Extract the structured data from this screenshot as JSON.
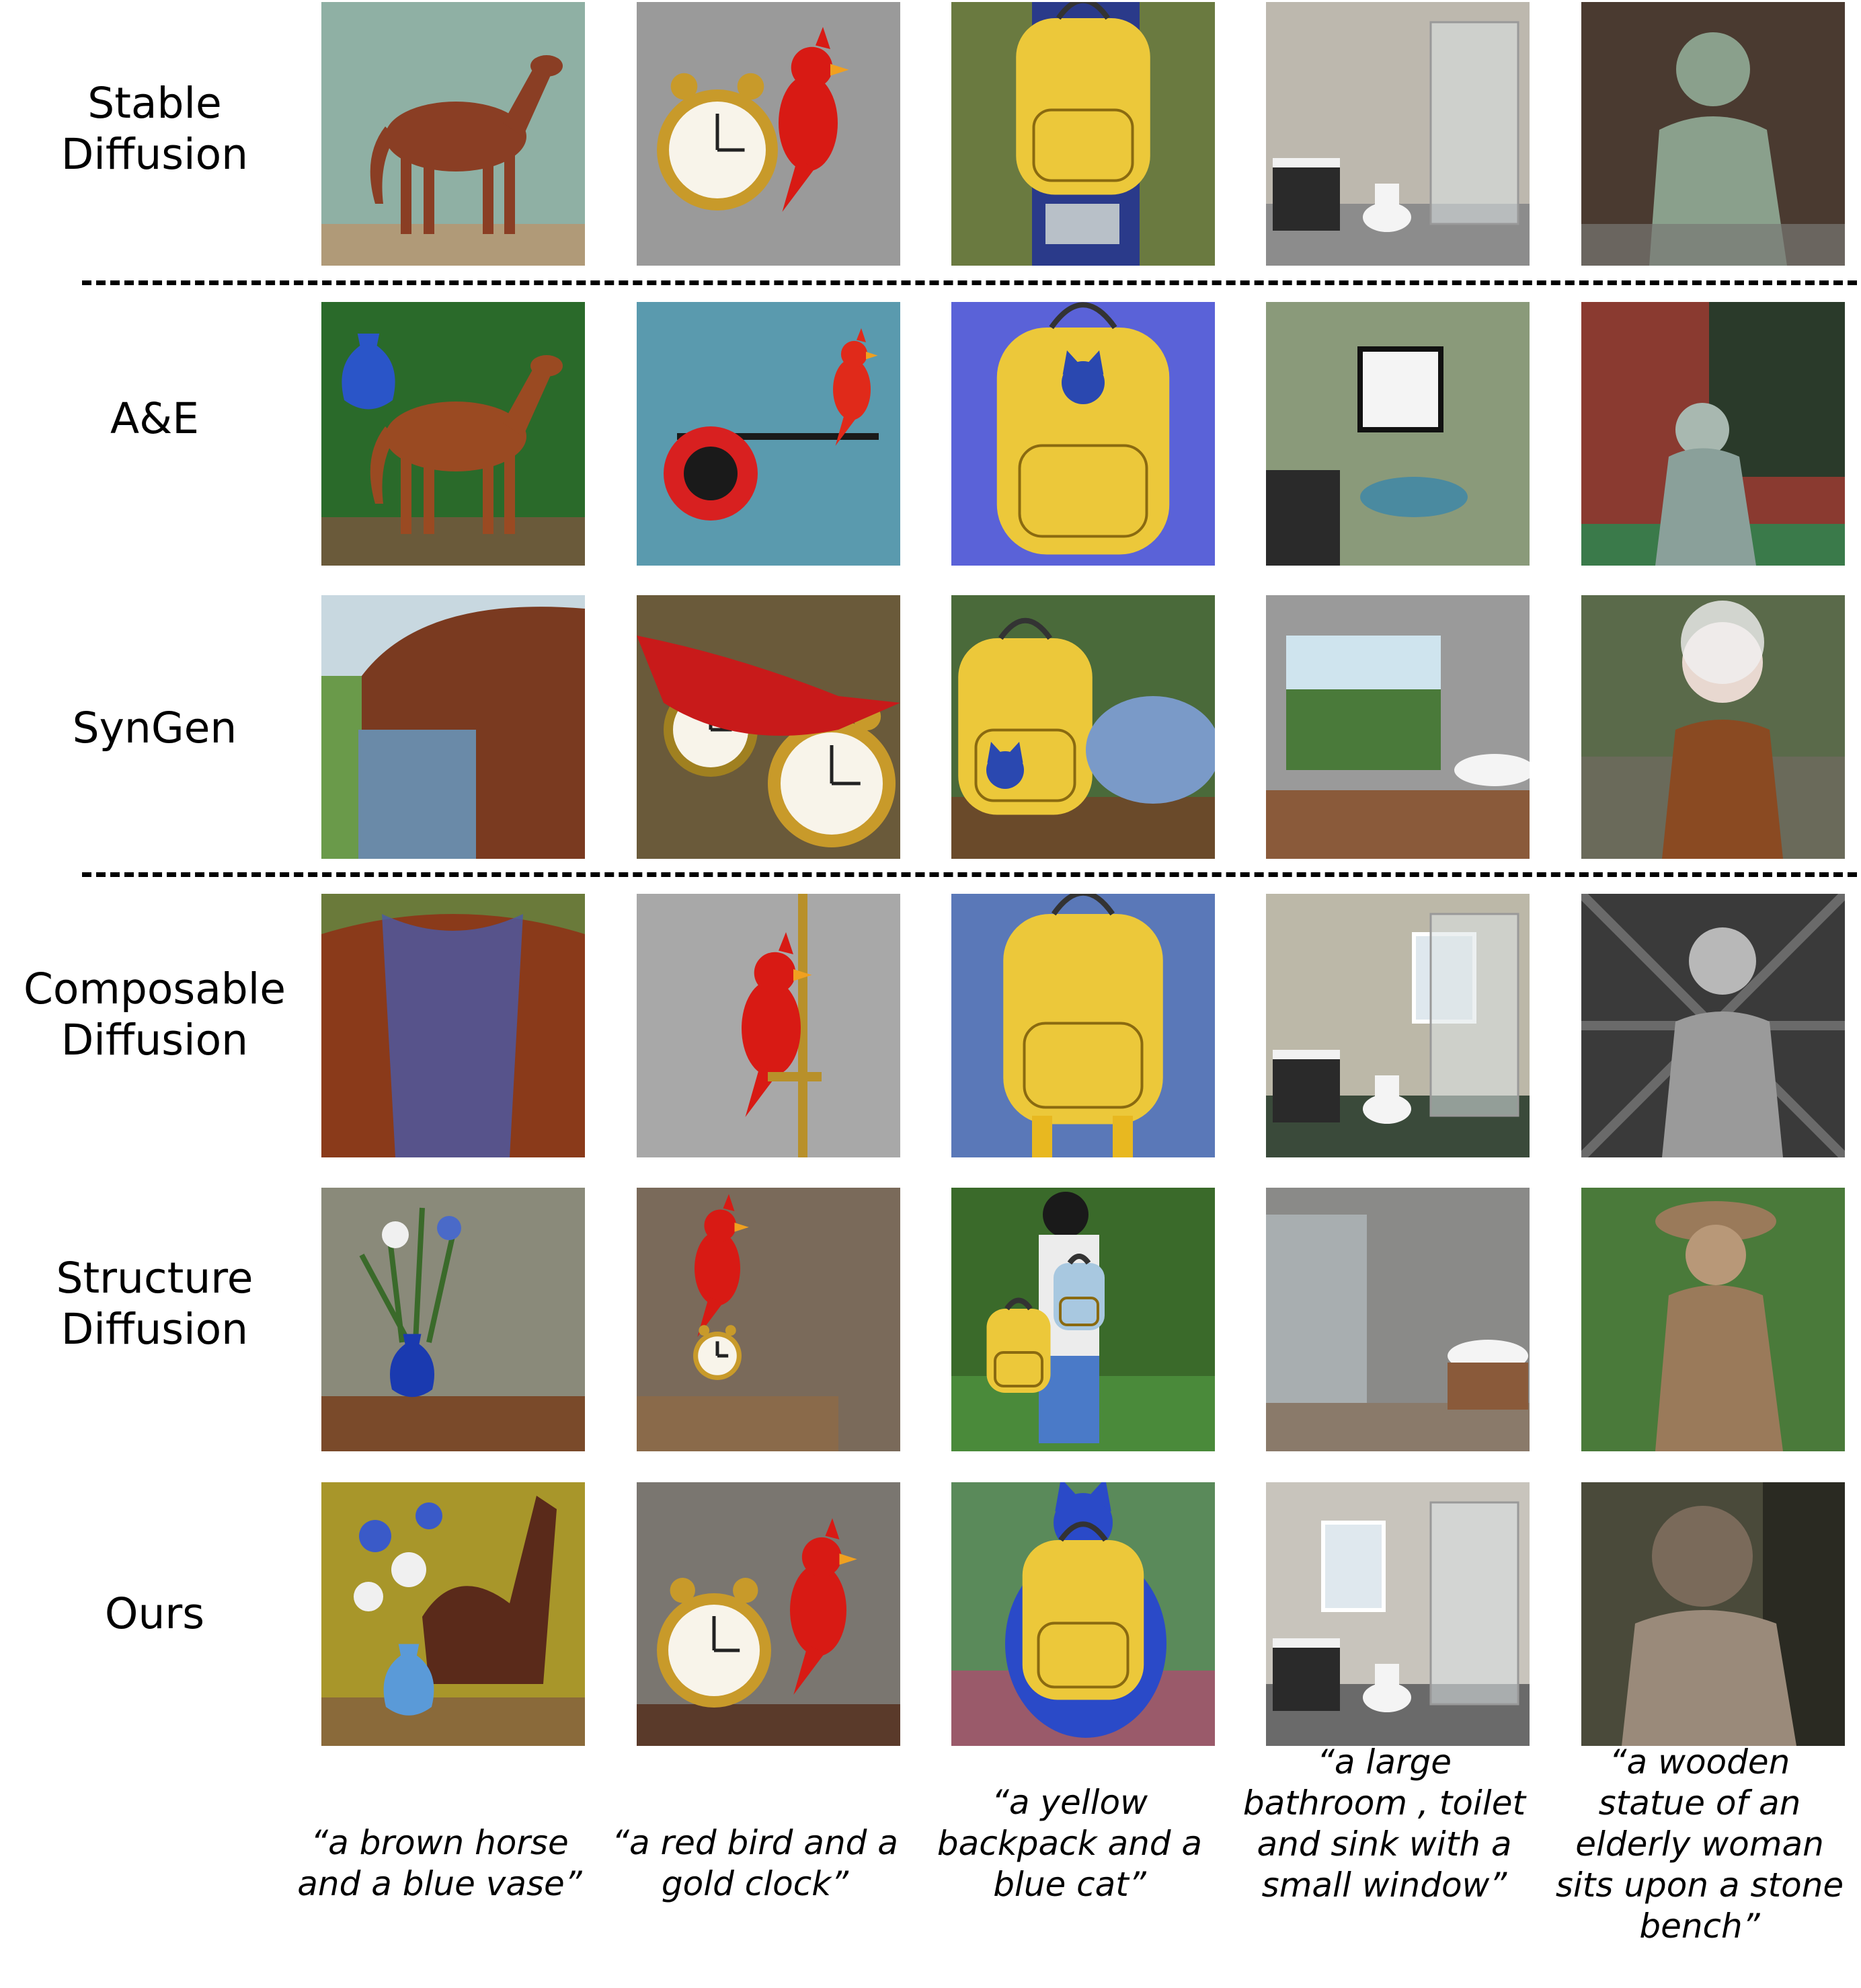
{
  "methods": [
    {
      "label": "Stable\nDiffusion"
    },
    {
      "label": "A&E"
    },
    {
      "label": "SynGen"
    },
    {
      "label": "Composable\nDiffusion"
    },
    {
      "label": "Structure\nDiffusion"
    },
    {
      "label": "Ours"
    }
  ],
  "prompts": [
    {
      "text": "“a brown horse and a blue vase”"
    },
    {
      "text": "“a red bird and a gold clock”"
    },
    {
      "text": "“a yellow backpack and a blue cat”"
    },
    {
      "text": "“a large bathroom , toilet and sink with a small window”"
    },
    {
      "text": "“a wooden statue of an elderly woman sits upon a stone bench”"
    }
  ],
  "colors": {
    "horse_brown": "#8a4a2a",
    "vase_blue": "#2a55c8",
    "bird_red": "#d81a14",
    "clock_gold": "#c89a2a",
    "backpack_yellow": "#ecc83a",
    "cat_blue": "#3a5ad0",
    "bathroom_gray": "#b8b4ac",
    "statue_wood": "#9a7a5a"
  }
}
